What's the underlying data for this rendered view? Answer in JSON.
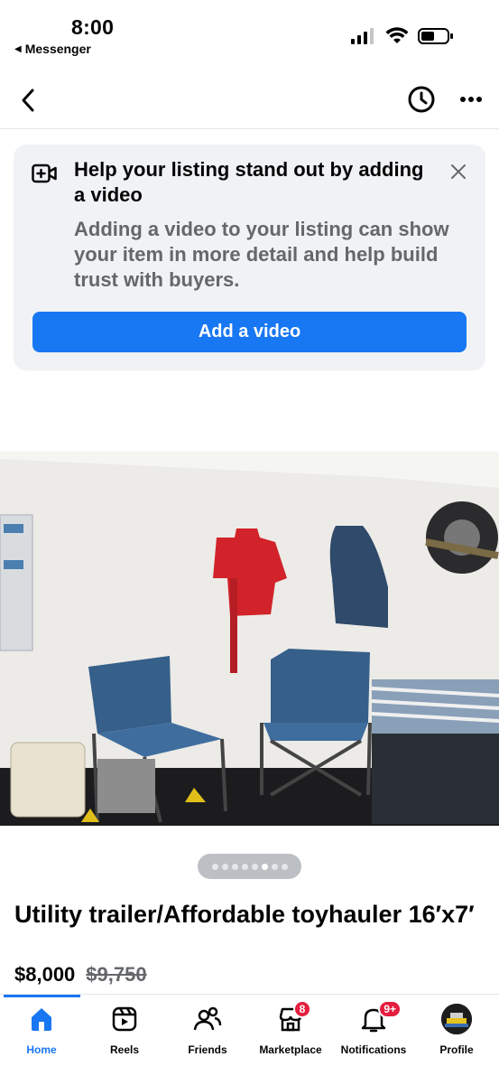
{
  "status_bar": {
    "time": "8:00",
    "back_app": "Messenger"
  },
  "promo_card": {
    "title": "Help your listing stand out by adding a video",
    "description": "Adding a video to your listing can show your item in more detail and help build trust with buyers.",
    "button_label": "Add a video"
  },
  "carousel": {
    "total": 8,
    "active_index": 5
  },
  "listing": {
    "title": "Utility trailer/Affordable toyhauler 16′x7′",
    "price": "$8,000",
    "original_price": "$9,750"
  },
  "tabs": [
    {
      "label": "Home",
      "icon": "home-icon",
      "active": true
    },
    {
      "label": "Reels",
      "icon": "reels-icon"
    },
    {
      "label": "Friends",
      "icon": "friends-icon"
    },
    {
      "label": "Marketplace",
      "icon": "marketplace-icon",
      "badge": "8"
    },
    {
      "label": "Notifications",
      "icon": "bell-icon",
      "badge": "9+"
    },
    {
      "label": "Profile",
      "icon": "avatar"
    }
  ],
  "colors": {
    "accent": "#1877f2",
    "badge": "#e41e3f",
    "card_bg": "#f0f2f5"
  }
}
